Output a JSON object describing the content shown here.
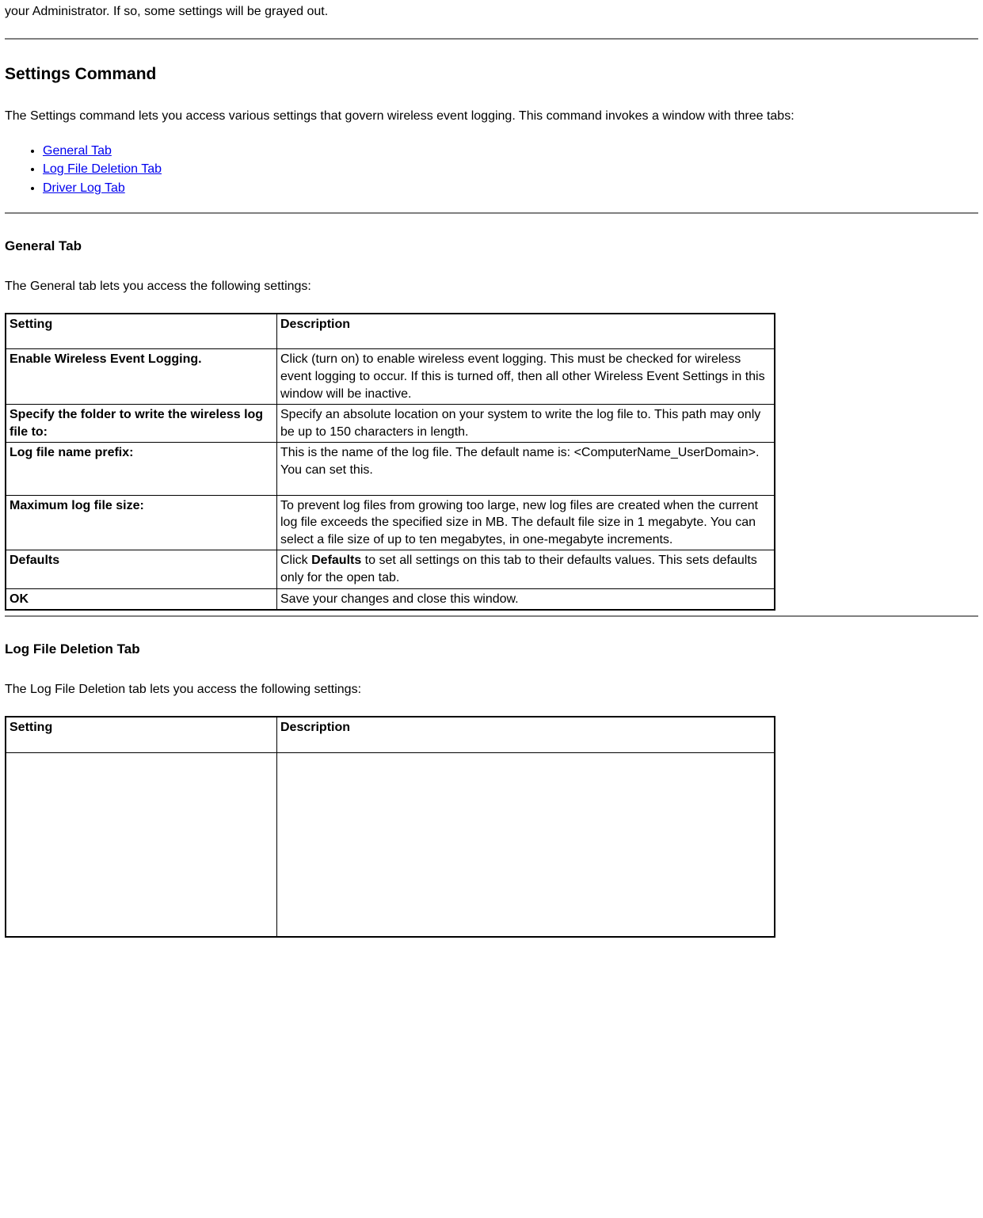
{
  "intro_fragment": "your Administrator. If so, some settings will be grayed out.",
  "settings_command": {
    "heading": "Settings Command",
    "paragraph": "The Settings command lets you access various settings that govern wireless event logging. This command invokes a window with three tabs:",
    "links": [
      "General Tab ",
      "Log File Deletion Tab",
      "Driver Log Tab"
    ]
  },
  "general_tab": {
    "heading": "General Tab",
    "paragraph": "The General tab lets you access the following settings:",
    "header": {
      "setting": "Setting",
      "description": "Description"
    },
    "rows": [
      {
        "setting": "Enable Wireless Event Logging.",
        "description": "Click (turn on) to enable wireless event logging. This must be checked for wireless event logging to occur. If this is turned off, then all other Wireless Event Settings in this window will be inactive."
      },
      {
        "setting": "Specify the folder to write the wireless log file to:",
        "description": "Specify an absolute location on your system to write the log file to. This path may only be up to 150 characters in length."
      },
      {
        "setting": "Log file name prefix:",
        "description": "This is the name of the log file. The default name is: <ComputerName_UserDomain>. You can set this."
      },
      {
        "setting": "Maximum log file size:",
        "description": "To prevent log files from growing too large, new log files are created when the current log file exceeds the specified size in MB. The default file size in 1 megabyte. You can select a file size of up to ten megabytes, in one-megabyte increments."
      },
      {
        "setting": "Defaults",
        "desc_prefix": "Click ",
        "desc_bold": "Defaults",
        "desc_suffix": " to set all settings on this tab to their defaults values. This sets defaults only for the open tab."
      },
      {
        "setting": "OK",
        "description": "Save your changes and close this window."
      }
    ]
  },
  "log_file_deletion_tab": {
    "heading": "Log File Deletion Tab",
    "paragraph": "The Log File Deletion tab lets you access the following settings:",
    "header": {
      "setting": "Setting",
      "description": "Description"
    }
  }
}
